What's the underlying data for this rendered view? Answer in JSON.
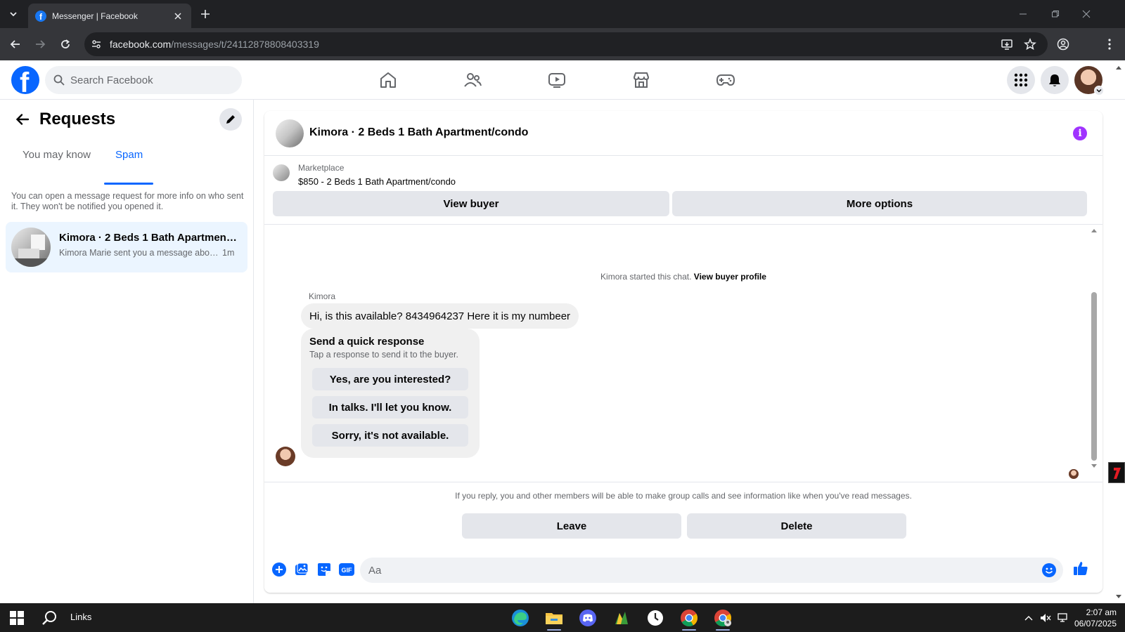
{
  "browser": {
    "tab_title": "Messenger | Facebook",
    "url_host": "facebook.com",
    "url_path": "/messages/t/24112878808403319"
  },
  "fb": {
    "logo_letter": "f",
    "search_placeholder": "Search Facebook"
  },
  "requests": {
    "title": "Requests",
    "tabs": [
      {
        "label": "You may know",
        "active": false
      },
      {
        "label": "Spam",
        "active": true
      }
    ],
    "note": "You can open a message request for more info on who sent it. They won't be notified you opened it.",
    "conversations": [
      {
        "name": "Kimora · 2 Beds 1 Bath Apartment/condo",
        "snippet": "Kimora Marie sent you a message about...",
        "time": "1m"
      }
    ]
  },
  "chat": {
    "title": "Kimora · 2 Beds 1 Bath Apartment/condo",
    "marketplace_label": "Marketplace",
    "marketplace_item": "$850 - 2 Beds 1 Bath Apartment/condo",
    "view_buyer": "View buyer",
    "more_options": "More options",
    "started_text": "Kimora started this chat.",
    "view_buyer_profile": "View buyer profile",
    "sender": "Kimora",
    "message": "Hi, is this available? 8434964237 Here it is my numbeer",
    "quick_title": "Send a quick response",
    "quick_sub": "Tap a response to send it to the buyer.",
    "quick_responses": [
      "Yes, are you interested?",
      "In talks. I'll let you know.",
      "Sorry, it's not available."
    ],
    "request_note": "If you reply, you and other members will be able to make group calls and see information like when you've read messages.",
    "leave": "Leave",
    "delete": "Delete",
    "composer_placeholder": "Aa",
    "composer_gif": "GIF"
  },
  "colors": {
    "fb_blue": "#0866ff",
    "info_purple": "#a033ff"
  },
  "taskbar": {
    "links_label": "Links",
    "time": "2:07 am",
    "date": "06/07/2025"
  }
}
